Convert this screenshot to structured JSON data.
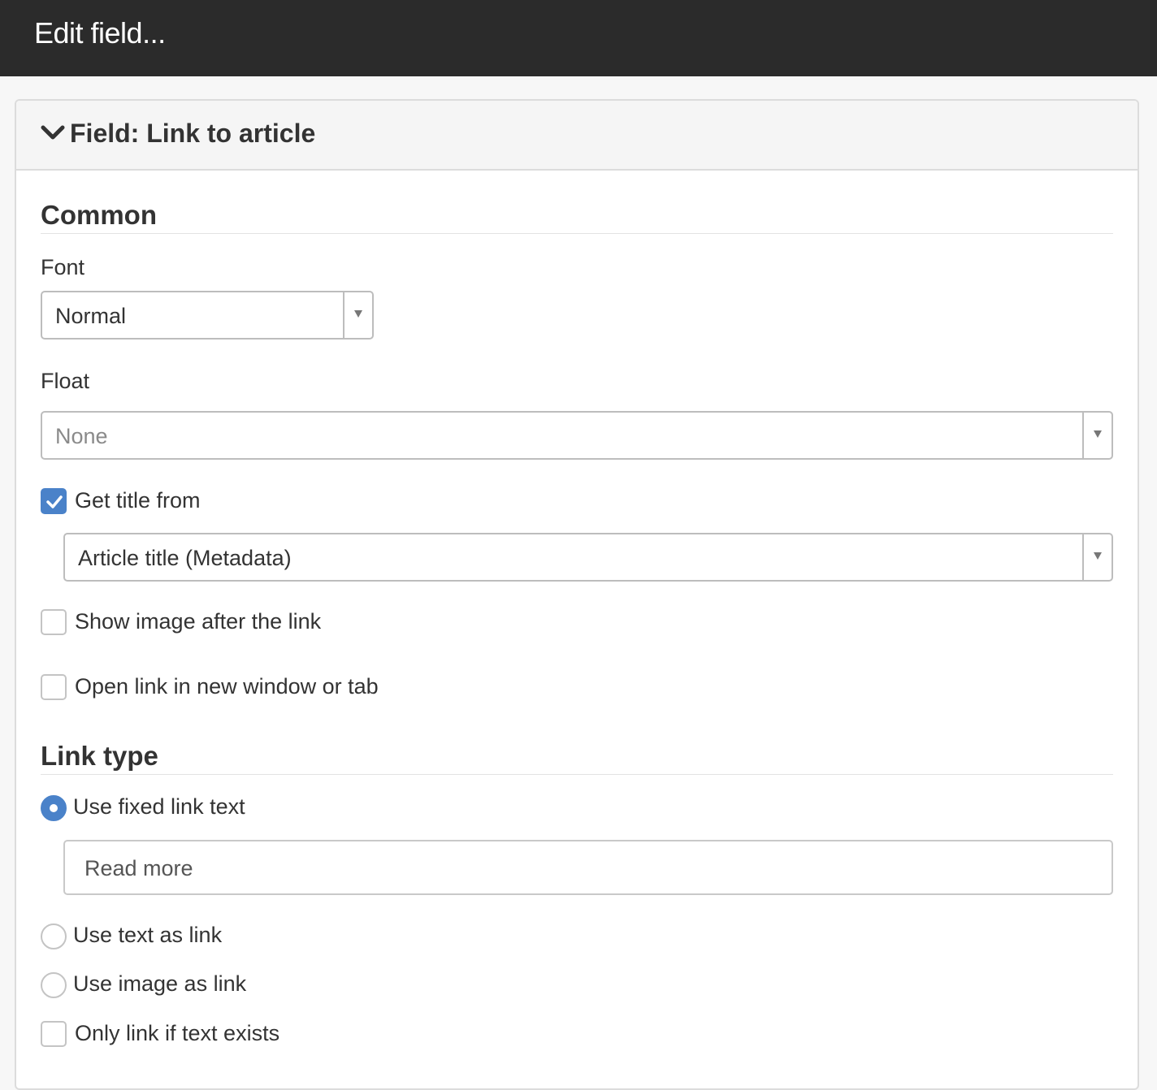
{
  "window": {
    "title": "Edit field..."
  },
  "panel": {
    "title": "Field: Link to article",
    "icon": "chevron-down-icon"
  },
  "common": {
    "heading": "Common",
    "font": {
      "label": "Font",
      "selected": "Normal"
    },
    "float": {
      "label": "Float",
      "selected": "None"
    },
    "get_title": {
      "label": "Get title from",
      "checked": true,
      "selected": "Article title (Metadata)"
    },
    "show_image": {
      "label": "Show image after the link",
      "checked": false
    },
    "new_window": {
      "label": "Open link in new window or tab",
      "checked": false
    }
  },
  "link_type": {
    "heading": "Link type",
    "fixed_text": {
      "label": "Use fixed link text",
      "selected": true,
      "value": "Read more"
    },
    "text_as_link": {
      "label": "Use text as link",
      "selected": false
    },
    "image_as_link": {
      "label": "Use image as link",
      "selected": false
    },
    "only_if_text": {
      "label": "Only link if text exists",
      "checked": false
    }
  },
  "colors": {
    "topbar": "#2b2b2b",
    "accent": "#4a82c9",
    "border": "#bdbdbd"
  }
}
